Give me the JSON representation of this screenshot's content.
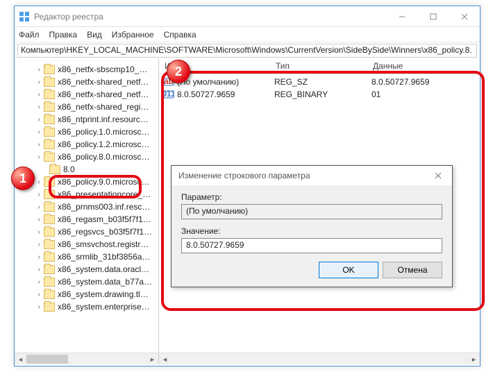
{
  "window": {
    "title": "Редактор реестра"
  },
  "menu": {
    "file": "Файл",
    "edit": "Правка",
    "view": "Вид",
    "favorites": "Избранное",
    "help": "Справка"
  },
  "address": "Компьютер\\HKEY_LOCAL_MACHINE\\SOFTWARE\\Microsoft\\Windows\\CurrentVersion\\SideBySide\\Winners\\x86_policy.8.",
  "tree": {
    "items": [
      "x86_netfx-sbscmp10_…",
      "x86_netfx-shared_netf…",
      "x86_netfx-shared_netf…",
      "x86_netfx-shared_regi…",
      "x86_ntprint.inf.resourc…",
      "x86_policy.1.0.microsc…",
      "x86_policy.1.2.microsc…",
      "x86_policy.8.0.microsc…",
      "x86_policy.9.0.microsc…",
      "x86_presentationcore_…",
      "x86_prnms003.inf.resc…",
      "x86_regasm_b03f5f7f1…",
      "x86_regsvcs_b03f5f7f1…",
      "x86_smsvchost.registr…",
      "x86_srmlib_31bf3856a…",
      "x86_system.data.oracl…",
      "x86_system.data_b77a…",
      "x86_system.drawing.tl…",
      "x86_system.enterprise…"
    ],
    "selected": "8.0"
  },
  "list": {
    "columns": {
      "name": "Имя",
      "type": "Тип",
      "data": "Данные"
    },
    "rows": [
      {
        "name": "(По умолчанию)",
        "type": "REG_SZ",
        "data": "8.0.50727.9659",
        "icon": "string"
      },
      {
        "name": "8.0.50727.9659",
        "type": "REG_BINARY",
        "data": "01",
        "icon": "binary"
      }
    ]
  },
  "dialog": {
    "title": "Изменение строкового параметра",
    "param_label": "Параметр:",
    "param_value": "(По умолчанию)",
    "value_label": "Значение:",
    "value_value": "8.0.50727.9659",
    "ok": "OK",
    "cancel": "Отмена"
  },
  "annotations": {
    "badge1": "1",
    "badge2": "2"
  }
}
